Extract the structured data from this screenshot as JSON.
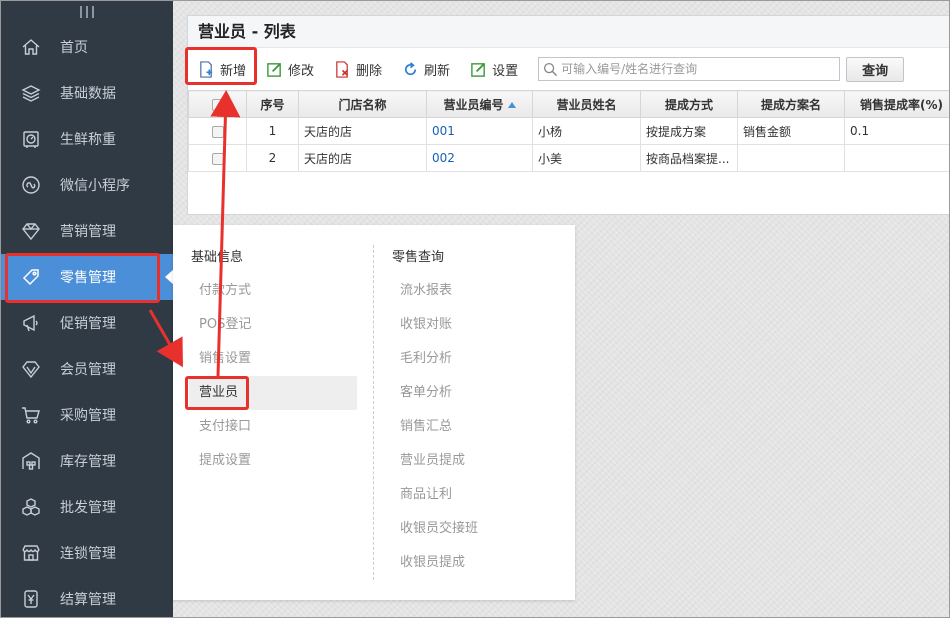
{
  "sidebar": {
    "items": [
      {
        "label": "首页",
        "icon": "home-icon"
      },
      {
        "label": "基础数据",
        "icon": "layers-icon"
      },
      {
        "label": "生鲜称重",
        "icon": "scale-icon"
      },
      {
        "label": "微信小程序",
        "icon": "mini-program-icon"
      },
      {
        "label": "营销管理",
        "icon": "diamond-icon"
      },
      {
        "label": "零售管理",
        "icon": "tag-icon",
        "active": true
      },
      {
        "label": "促销管理",
        "icon": "megaphone-icon"
      },
      {
        "label": "会员管理",
        "icon": "gem-icon"
      },
      {
        "label": "采购管理",
        "icon": "cart-icon"
      },
      {
        "label": "库存管理",
        "icon": "warehouse-icon"
      },
      {
        "label": "批发管理",
        "icon": "boxes-icon"
      },
      {
        "label": "连锁管理",
        "icon": "store-icon"
      },
      {
        "label": "结算管理",
        "icon": "yen-icon"
      }
    ]
  },
  "panel": {
    "title": "营业员 - 列表",
    "toolbar": {
      "add": "新增",
      "edit": "修改",
      "delete": "删除",
      "refresh": "刷新",
      "settings": "设置",
      "search_placeholder": "可输入编号/姓名进行查询",
      "query": "查询"
    },
    "table": {
      "headers": [
        "序号",
        "门店名称",
        "营业员编号",
        "营业员姓名",
        "提成方式",
        "提成方案名",
        "销售提成率(%)"
      ],
      "rows": [
        [
          "1",
          "天店的店",
          "001",
          "小杨",
          "按提成方案",
          "销售金额",
          "0.1"
        ],
        [
          "2",
          "天店的店",
          "002",
          "小美",
          "按商品档案提...",
          "",
          ""
        ]
      ]
    }
  },
  "menu": {
    "left": {
      "heading": "基础信息",
      "items": [
        "付款方式",
        "POS登记",
        "销售设置",
        "营业员",
        "支付接口",
        "提成设置"
      ],
      "active_index": 3
    },
    "right": {
      "heading": "零售查询",
      "items": [
        "流水报表",
        "收银对账",
        "毛利分析",
        "客单分析",
        "销售汇总",
        "营业员提成",
        "商品让利",
        "收银员交接班",
        "收银员提成"
      ]
    }
  },
  "colors": {
    "sidebar_bg": "#2f3a45",
    "active_blue": "#4b8fd8",
    "highlight_red": "#e8312c"
  }
}
